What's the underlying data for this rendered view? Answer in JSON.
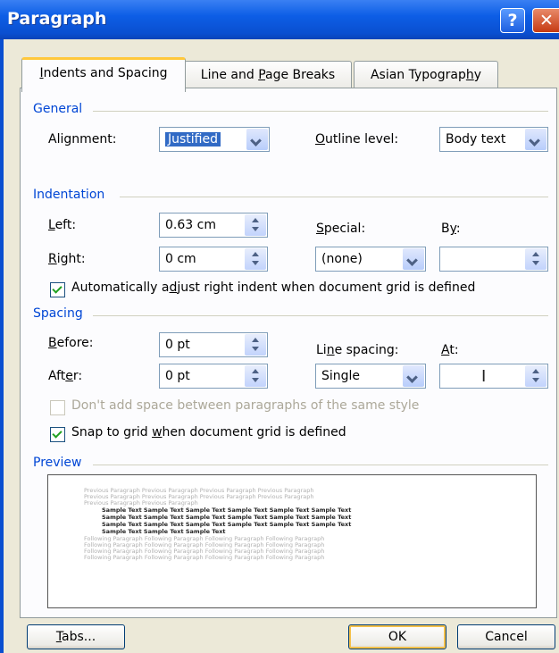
{
  "window": {
    "title": "Paragraph"
  },
  "tabs": [
    {
      "label_pre": "",
      "label_key": "I",
      "label_post": "ndents and Spacing"
    },
    {
      "label_pre": "Line and ",
      "label_key": "P",
      "label_post": "age Breaks"
    },
    {
      "label_pre": "Asian Typograp",
      "label_key": "h",
      "label_post": "y"
    }
  ],
  "general": {
    "heading": "General",
    "alignment_label": "Alignment:",
    "alignment_value": "Justified",
    "outline_label_key": "O",
    "outline_label_rest": "utline level:",
    "outline_value": "Body text"
  },
  "indentation": {
    "heading": "Indentation",
    "left_key": "L",
    "left_rest": "eft:",
    "left_value": "0.63 cm",
    "right_key": "R",
    "right_rest": "ight:",
    "right_value": "0 cm",
    "special_key": "S",
    "special_rest": "pecial:",
    "special_value": "(none)",
    "by_pre": "B",
    "by_key": "y",
    "by_post": ":",
    "by_value": "",
    "auto_adjust_pre": "Automatically a",
    "auto_adjust_key": "d",
    "auto_adjust_post": "just right indent when document grid is defined"
  },
  "spacing": {
    "heading": "Spacing",
    "before_key": "B",
    "before_rest": "efore:",
    "before_value": "0 pt",
    "after_pre": "Aft",
    "after_key": "e",
    "after_post": "r:",
    "after_value": "0 pt",
    "line_pre": "Li",
    "line_key": "n",
    "line_post": "e spacing:",
    "line_value": "Single",
    "at_key": "A",
    "at_rest": "t:",
    "at_value": "",
    "dont_add": "Don't add space between paragraphs of the same style",
    "snap_pre": "Snap to grid ",
    "snap_key": "w",
    "snap_post": "hen document grid is defined"
  },
  "preview": {
    "heading": "Preview",
    "previous_lines": [
      "Previous Paragraph Previous Paragraph Previous Paragraph Previous Paragraph",
      "Previous Paragraph Previous Paragraph Previous Paragraph Previous Paragraph",
      "Previous Paragraph Previous Paragraph"
    ],
    "sample_lines": [
      "Sample Text Sample Text Sample Text Sample Text Sample Text Sample Text",
      "Sample Text Sample Text Sample Text Sample Text Sample Text Sample Text",
      "Sample Text Sample Text Sample Text Sample Text Sample Text Sample Text",
      "Sample Text Sample Text Sample Text"
    ],
    "following_lines": [
      "Following Paragraph Following Paragraph Following Paragraph Following Paragraph",
      "Following Paragraph Following Paragraph Following Paragraph Following Paragraph",
      "Following Paragraph Following Paragraph Following Paragraph Following Paragraph",
      "Following Paragraph Following Paragraph Following Paragraph Following Paragraph"
    ]
  },
  "buttons": {
    "tabs_key": "T",
    "tabs_rest": "abs...",
    "ok": "OK",
    "cancel": "Cancel"
  },
  "colors": {
    "titlebar": "#0a4fd0",
    "group_heading": "#0046d5",
    "selection": "#316ac5",
    "dialog_bg": "#ece9d8"
  }
}
